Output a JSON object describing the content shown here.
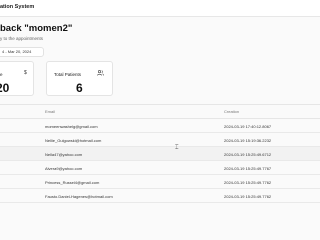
{
  "header": {
    "app_title": "ation System"
  },
  "welcome": "back \"momen2\"",
  "subtitle": "y to the appointments",
  "date_range": "4 - Mar 20, 2024",
  "cards": [
    {
      "label": "e",
      "value": "20",
      "icon": "dollar-icon"
    },
    {
      "label": "Total Patients",
      "value": "6",
      "icon": "users-icon"
    }
  ],
  "table": {
    "columns": {
      "email": "Email",
      "created": "Creation"
    },
    "rows": [
      {
        "email": "momeenwashelg@gmail.com",
        "created": "2024-03-19 17:40:12.8067"
      },
      {
        "email": "Nellie_Gulgowski@hotmail.com",
        "created": "2024-03-19 15:19:36.2232"
      },
      {
        "email": "Nella47@yahoo.com",
        "created": "2024-03-19 15:25:49.6712"
      },
      {
        "email": "Alvera9@yahoo.com",
        "created": "2024-03-19 15:25:49.7767"
      },
      {
        "email": "Princess_Russel4@gmail.com",
        "created": "2024-03-19 15:25:49.7762"
      },
      {
        "email": "Fausto.Daniel-Hagenes@hotmail.com",
        "created": "2024-03-19 15:25:49.7762"
      }
    ]
  }
}
